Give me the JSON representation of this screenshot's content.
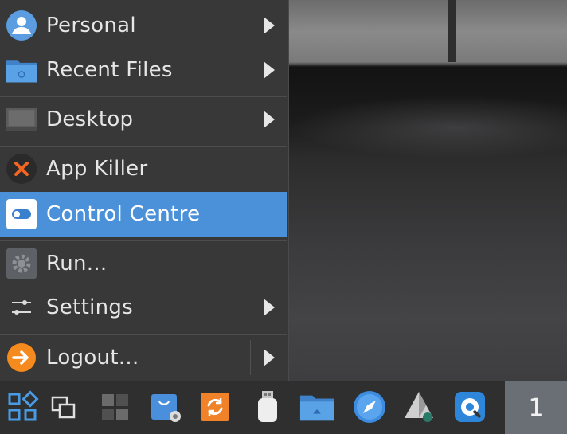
{
  "menu": {
    "items": [
      {
        "label": "Personal",
        "icon": "user-icon",
        "submenu": true
      },
      {
        "label": "Recent Files",
        "icon": "folder-icon",
        "submenu": true
      },
      {
        "label": "Desktop",
        "icon": "desktop-icon",
        "submenu": true
      },
      {
        "label": "App Killer",
        "icon": "kill-icon",
        "submenu": false
      },
      {
        "label": "Control Centre",
        "icon": "toggle-icon",
        "submenu": false,
        "active": true
      },
      {
        "label": "Run...",
        "icon": "gear-icon",
        "submenu": false
      },
      {
        "label": "Settings",
        "icon": "sliders-icon",
        "submenu": true
      },
      {
        "label": "Logout...",
        "icon": "logout-icon",
        "submenu": true
      }
    ]
  },
  "taskbar": {
    "icons": [
      "apps-grid-icon",
      "window-switcher-icon",
      "workspaces-icon",
      "software-store-icon",
      "update-icon",
      "usb-drive-icon",
      "files-folder-icon",
      "web-browser-icon",
      "disk-utility-icon",
      "settings-tool-icon"
    ],
    "workspace_number": "1"
  },
  "colors": {
    "menu_bg": "#383838",
    "highlight": "#4a91d9",
    "taskbar_bg": "#2f2f2f"
  }
}
